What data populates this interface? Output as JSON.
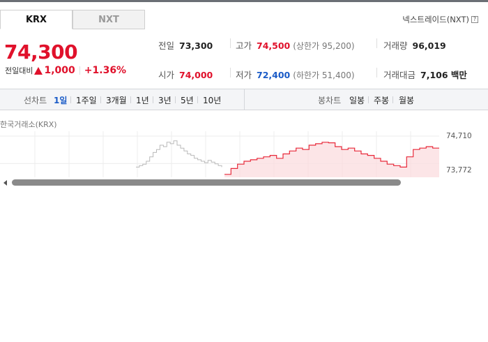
{
  "tabs": [
    {
      "label": "KRX",
      "active": true
    },
    {
      "label": "NXT",
      "active": false
    }
  ],
  "nxt_link": {
    "label": "넥스트레이드(NXT)",
    "icon": "help-icon"
  },
  "price": "74,300",
  "change": {
    "label": "전일대비",
    "icon": "up-triangle-icon",
    "amount": "1,000",
    "rate": "+1.36%"
  },
  "stats": {
    "prev_close": {
      "label": "전일",
      "value": "73,300"
    },
    "high": {
      "label": "고가",
      "value": "74,500",
      "sub": "(상한가 95,200)"
    },
    "volume": {
      "label": "거래량",
      "value": "96,019"
    },
    "open": {
      "label": "시가",
      "value": "74,000"
    },
    "low": {
      "label": "저가",
      "value": "72,400",
      "sub": "(하한가 51,400)"
    },
    "amount": {
      "label": "거래대금",
      "value": "7,106 백만"
    }
  },
  "line_chart_periods": {
    "label": "선차트",
    "items": [
      "1일",
      "1주일",
      "3개월",
      "1년",
      "3년",
      "5년",
      "10년"
    ],
    "active": "1일"
  },
  "candle_chart_periods": {
    "label": "봉차트",
    "items": [
      "일봉",
      "주봉",
      "월봉"
    ]
  },
  "exchange_label": "한국거래소(KRX)",
  "chart_data": {
    "type": "line",
    "y_tick_labels": [
      "74,710",
      "73,772"
    ],
    "series": [
      {
        "values": [
          73650,
          73700,
          73750,
          73850,
          74000,
          74150,
          74250,
          74400,
          74350,
          74500,
          74450,
          74550,
          74400,
          74300,
          74200,
          74100,
          74050,
          73950,
          73900,
          73850,
          73800,
          73880,
          73820,
          73760,
          73700,
          73650
        ]
      },
      {
        "values": [
          73400,
          73600,
          73750,
          73850,
          73900,
          73950,
          74000,
          74050,
          73950,
          74100,
          74200,
          74300,
          74250,
          74400,
          74450,
          74500,
          74480,
          74350,
          74250,
          74300,
          74200,
          74100,
          74050,
          73950,
          73850,
          73750,
          73700,
          73650,
          74000,
          74250,
          74300,
          74350,
          74300,
          74300
        ]
      }
    ],
    "colors": {
      "series_0": "#b9b9b9",
      "series_1": "#e8293a",
      "area": "#fbdcdf"
    }
  }
}
